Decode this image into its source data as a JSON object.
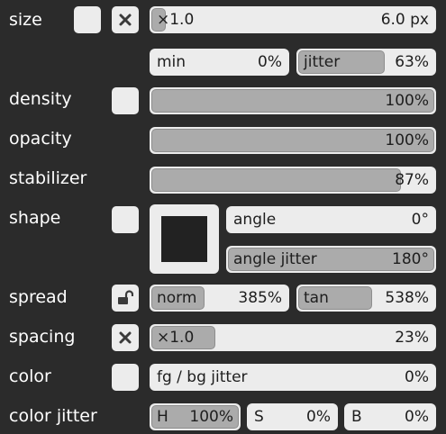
{
  "size": {
    "label": "size",
    "multiplier": "×1.0",
    "value": "6.0 px",
    "fill_fraction": 0.05,
    "min_label": "min",
    "min_value": "0%",
    "jitter_label": "jitter",
    "jitter_value": "63%",
    "jitter_fill_fraction": 0.63
  },
  "density": {
    "label": "density",
    "value": "100%",
    "fill_fraction": 1.0
  },
  "opacity": {
    "label": "opacity",
    "value": "100%",
    "fill_fraction": 1.0
  },
  "stabilizer": {
    "label": "stabilizer",
    "value": "87%",
    "fill_fraction": 0.87
  },
  "shape": {
    "label": "shape",
    "angle_label": "angle",
    "angle_value": "0°",
    "angle_jitter_label": "angle jitter",
    "angle_jitter_value": "180°",
    "angle_jitter_fill_fraction": 1.0
  },
  "spread": {
    "label": "spread",
    "norm_label": "norm",
    "norm_value": "385%",
    "tan_label": "tan",
    "tan_value": "538%"
  },
  "spacing": {
    "label": "spacing",
    "multiplier": "×1.0",
    "value": "23%",
    "fill_fraction": 0.23
  },
  "color": {
    "label": "color",
    "fgbg_label": "fg / bg jitter",
    "fgbg_value": "0%"
  },
  "color_jitter": {
    "label": "color jitter",
    "h_label": "H",
    "h_value": "100%",
    "s_label": "S",
    "s_value": "0%",
    "b_label": "B",
    "b_value": "0%"
  },
  "icons": [
    "close-icon",
    "unlock-icon"
  ],
  "colors": {
    "background": "#2b2b2b",
    "field": "#ececec",
    "fill": "#ababab",
    "text": "#1e1e1e"
  }
}
